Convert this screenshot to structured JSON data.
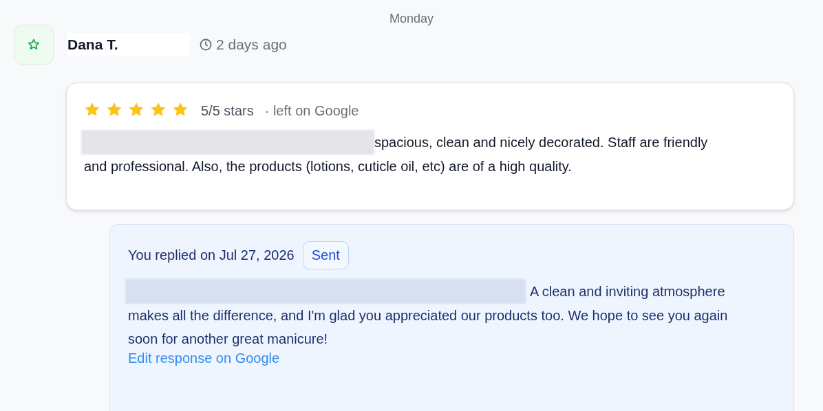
{
  "day_label": "Monday",
  "review": {
    "author": "Dana T.",
    "time": "2 days ago",
    "stars": 5,
    "rating_text": "5/5 stars",
    "source": "· left on Google",
    "body_lines": [
      "spacious, clean and nicely decorated. Staff are friendly",
      "and professional. Also, the products (lotions, cuticle oil, etc) are of a high quality."
    ]
  },
  "reply": {
    "header": "You replied on Jul 27, 2026",
    "status": "Sent",
    "body_lines": [
      "A clean and inviting atmosphere",
      "makes all the difference, and I'm glad you appreciated our products too. We hope to see you again soon for another great manicure!"
    ],
    "edit_link": "Edit response on Google"
  }
}
